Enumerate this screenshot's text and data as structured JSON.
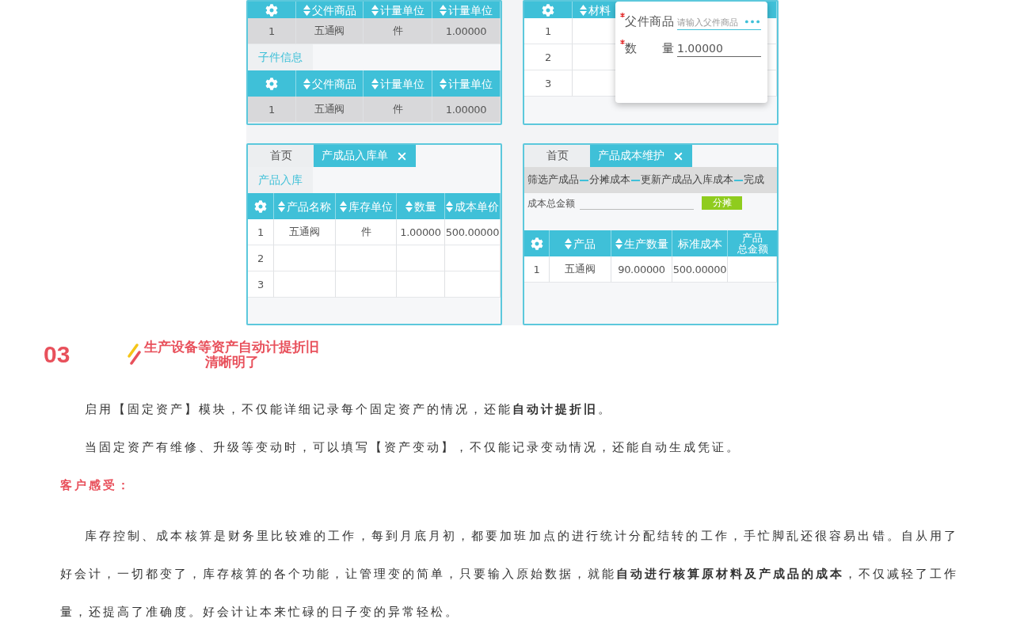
{
  "screenshots": [
    {
      "blocks": [
        {
          "kind": "table",
          "columns": [
            {
              "kind": "gear"
            },
            {
              "kind": "text",
              "label": "父件商品",
              "sortable": true
            },
            {
              "kind": "text",
              "label": "计量单位",
              "sortable": true
            },
            {
              "kind": "text",
              "label": "计量单位",
              "sortable": true
            }
          ],
          "rows": [
            {
              "cells": [
                "1",
                "五通阀",
                "件",
                "1.00000"
              ],
              "selected": true
            }
          ]
        },
        {
          "kind": "section_label",
          "text": "子件信息"
        },
        {
          "kind": "table",
          "columns": [
            {
              "kind": "gear"
            },
            {
              "kind": "text",
              "label": "父件商品",
              "sortable": true
            },
            {
              "kind": "text",
              "label": "计量单位",
              "sortable": true
            },
            {
              "kind": "text",
              "label": "计量单位",
              "sortable": true
            }
          ],
          "rows": [
            {
              "cells": [
                "1",
                "五通阀",
                "件",
                "1.00000"
              ],
              "selected": true
            }
          ]
        }
      ]
    },
    {
      "blocks": [
        {
          "kind": "table",
          "columns": [
            {
              "kind": "gear"
            },
            {
              "kind": "text",
              "label": "材料",
              "sortable": true
            }
          ],
          "rows": [
            {
              "cells": [
                "1"
              ],
              "selected": false
            },
            {
              "cells": [
                "2"
              ],
              "selected": false
            },
            {
              "cells": [
                "3"
              ],
              "selected": false
            }
          ]
        }
      ],
      "popup": {
        "fields": [
          {
            "label": "父件商品",
            "required": true,
            "placeholder": "请输入父件商品",
            "picker": true
          },
          {
            "label": "数 量",
            "required": true,
            "value": "1.00000",
            "picker": false
          }
        ]
      }
    },
    {
      "blocks": [
        {
          "kind": "tabs",
          "tabs": [
            {
              "label": "首页",
              "selected": false,
              "closable": false
            },
            {
              "label": "产成品入库单",
              "selected": true,
              "closable": true
            }
          ]
        },
        {
          "kind": "section_label",
          "text": "产品入库"
        },
        {
          "kind": "table",
          "columns": [
            {
              "kind": "gear"
            },
            {
              "kind": "text",
              "label": "产品名称",
              "sortable": true
            },
            {
              "kind": "text",
              "label": "库存单位",
              "sortable": true
            },
            {
              "kind": "text",
              "label": "数量",
              "sortable": true
            },
            {
              "kind": "text",
              "label": "成本单价",
              "sortable": true
            }
          ],
          "rows": [
            {
              "cells": [
                "1",
                "五通阀",
                "件",
                "1.00000",
                "500.00000"
              ],
              "selected": false
            },
            {
              "cells": [
                "2"
              ],
              "selected": false
            },
            {
              "cells": [
                "3"
              ],
              "selected": false
            }
          ]
        }
      ]
    },
    {
      "blocks": [
        {
          "kind": "tabs",
          "tabs": [
            {
              "label": "首页",
              "selected": false,
              "closable": false
            },
            {
              "label": "产品成本维护",
              "selected": true,
              "closable": true
            }
          ]
        },
        {
          "kind": "steps",
          "steps": [
            "筛选产成品",
            "分摊成本",
            "更新产成品入库成本",
            "完成"
          ]
        },
        {
          "kind": "amount",
          "label": "成本总金额",
          "button": "分摊"
        },
        {
          "kind": "table",
          "columns": [
            {
              "kind": "gear"
            },
            {
              "kind": "text",
              "label": "产品",
              "sortable": true
            },
            {
              "kind": "text",
              "label": "生产数量",
              "sortable": true
            },
            {
              "kind": "text",
              "label": "标准成本",
              "sortable": false
            },
            {
              "kind": "lines",
              "lines": [
                "产品",
                "总金额"
              ],
              "sortable": false
            }
          ],
          "rows": [
            {
              "cells": [
                "1",
                "五通阀",
                "90.00000",
                "500.00000"
              ],
              "selected": false
            }
          ]
        }
      ]
    }
  ],
  "section": {
    "number": "03",
    "title_lines": [
      "生产设备等资产自动计提折旧",
      "清晰明了"
    ],
    "paragraphs": [
      {
        "kind": "body",
        "text": "启用【固定资产】模块，不仅能详细记录每个固定资产的情况，还能**自动计提折旧**。"
      },
      {
        "kind": "body",
        "text": "当固定资产有维修、升级等变动时，可以填写【资产变动】，不仅能记录变动情况，还能自动生成凭证。"
      },
      {
        "kind": "heading",
        "text": "客户感受："
      },
      {
        "kind": "body",
        "text": "库存控制、成本核算是财务里比较难的工作，每到月底月初，都要加班加点的进行统计分配结转的工作，手忙脚乱还很容易出错。自从用了好会计，一切都变了，库存核算的各个功能，让管理变的简单，只要输入原始数据，就能**自动进行核算原材料及产成品的成本**，不仅减轻了工作量，还提高了准确度。好会计让本来忙碌的日子变的异常轻松。"
      }
    ]
  }
}
